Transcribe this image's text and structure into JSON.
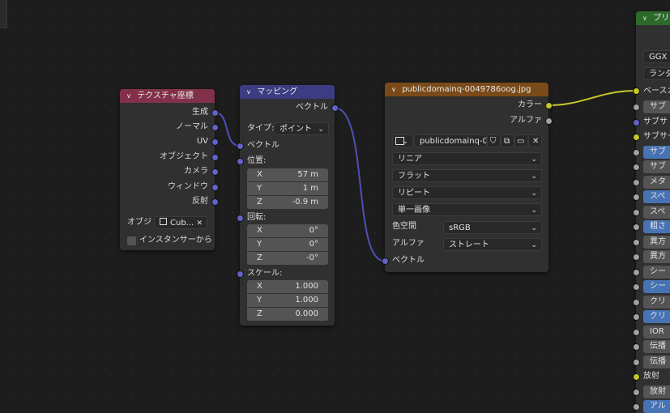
{
  "tex_coord": {
    "title": "テクスチャ座標",
    "outputs": [
      "生成",
      "ノーマル",
      "UV",
      "オブジェクト",
      "カメラ",
      "ウィンドウ",
      "反射"
    ],
    "object_label": "オブジ",
    "object_value": "Cub...",
    "instancer_label": "インスタンサーから"
  },
  "mapping": {
    "title": "マッピング",
    "output": "ベクトル",
    "type_label": "タイプ:",
    "type_value": "ポイント",
    "vector_label": "ベクトル",
    "location_label": "位置:",
    "location": [
      {
        "axis": "X",
        "value": "57 m"
      },
      {
        "axis": "Y",
        "value": "1 m"
      },
      {
        "axis": "Z",
        "value": "-0.9 m"
      }
    ],
    "rotation_label": "回転:",
    "rotation": [
      {
        "axis": "X",
        "value": "0°"
      },
      {
        "axis": "Y",
        "value": "0°"
      },
      {
        "axis": "Z",
        "value": "-0°"
      }
    ],
    "scale_label": "スケール:",
    "scale": [
      {
        "axis": "X",
        "value": "1.000"
      },
      {
        "axis": "Y",
        "value": "1.000"
      },
      {
        "axis": "Z",
        "value": "0.000"
      }
    ]
  },
  "image_tex": {
    "title": "publicdomainq-0049786oog.jpg",
    "out_color": "カラー",
    "out_alpha": "アルファ",
    "image_name": "publicdomainq-00...",
    "interpolation": "リニア",
    "projection": "フラット",
    "extension": "リピート",
    "source": "単一画像",
    "colorspace_label": "色空間",
    "colorspace_value": "sRGB",
    "alpha_label": "アルファ",
    "alpha_value": "ストレート",
    "vector_label": "ベクトル"
  },
  "principled": {
    "title": "プリン",
    "distribution": "GGX",
    "subsurface_method": "ランダ",
    "base_color_label": "ベースカ",
    "rows": [
      {
        "label": "サブ",
        "style": "gray"
      },
      {
        "label": "サブサ",
        "style": "plain"
      },
      {
        "label": "サブサー",
        "style": "plain"
      },
      {
        "label": "サブ",
        "style": "blue"
      },
      {
        "label": "サブ",
        "style": "gray"
      },
      {
        "label": "メタ",
        "style": "gray"
      },
      {
        "label": "スペ",
        "style": "blue"
      },
      {
        "label": "スペ",
        "style": "gray"
      },
      {
        "label": "粗さ",
        "style": "blue"
      },
      {
        "label": "異方",
        "style": "gray"
      },
      {
        "label": "異方",
        "style": "gray"
      },
      {
        "label": "シー",
        "style": "gray"
      },
      {
        "label": "シー",
        "style": "blue"
      },
      {
        "label": "クリ",
        "style": "gray"
      },
      {
        "label": "クリ",
        "style": "blue"
      },
      {
        "label": "IOR",
        "style": "gray"
      },
      {
        "label": "伝播",
        "style": "gray"
      },
      {
        "label": "伝播",
        "style": "gray"
      },
      {
        "label": "放射",
        "style": "plain"
      },
      {
        "label": "放射",
        "style": "gray"
      },
      {
        "label": "アル",
        "style": "blue"
      }
    ]
  },
  "colors": {
    "vector_socket": "#6363c7",
    "color_socket": "#c7c729",
    "float_socket": "#a1a1a1",
    "link_vector": "#4f4fb8",
    "link_color": "#c7c729"
  }
}
